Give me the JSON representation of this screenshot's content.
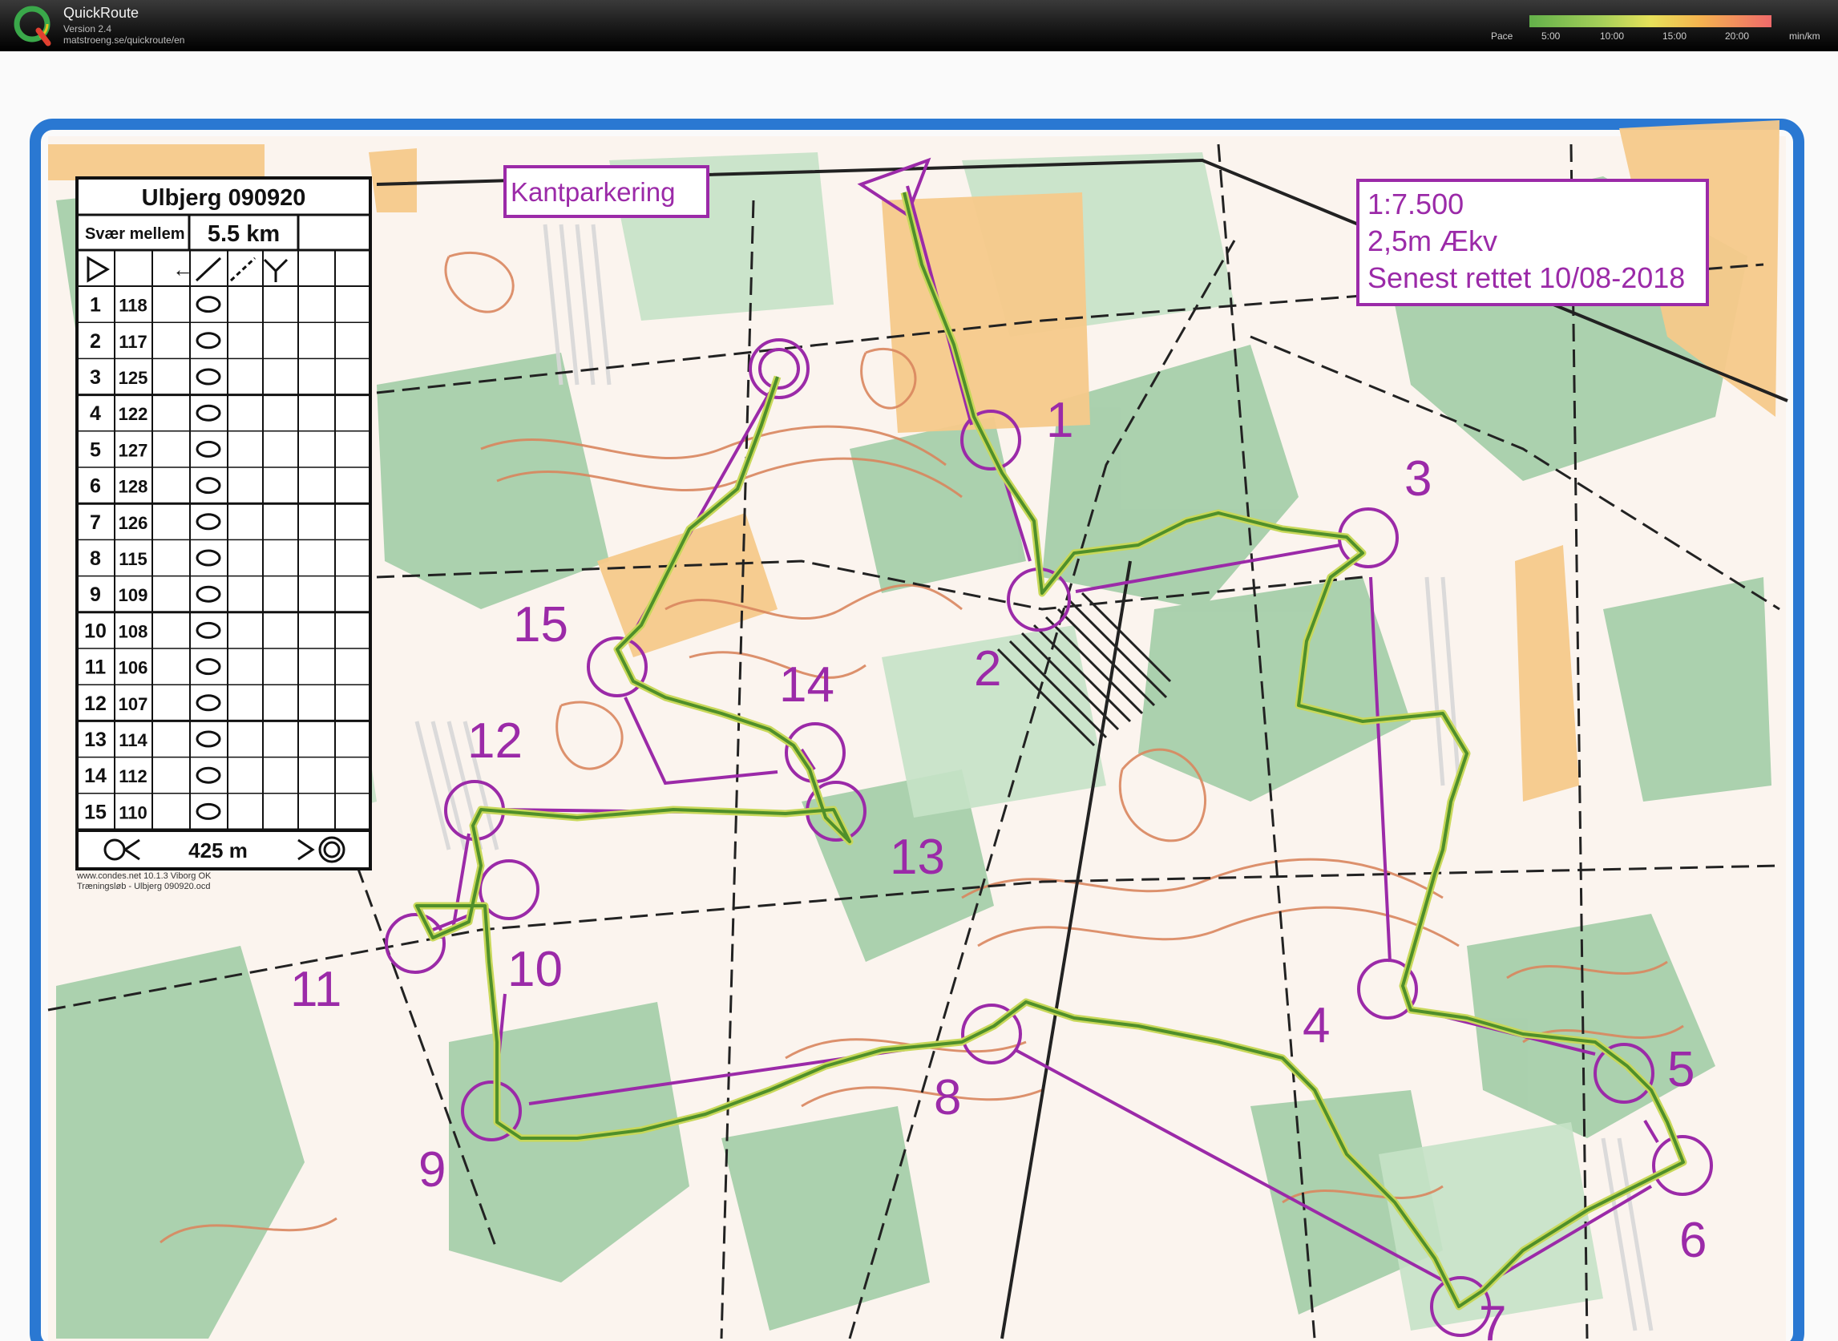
{
  "app": {
    "name": "QuickRoute",
    "version": "Version 2.4",
    "url": "matstroeng.se/quickroute/en"
  },
  "pace_legend": {
    "label": "Pace",
    "ticks": [
      "5:00",
      "10:00",
      "15:00",
      "20:00"
    ],
    "unit": "min/km"
  },
  "map": {
    "parking_label": "Kantparkering",
    "scale_box": [
      "1:7.500",
      "2,5m Ækv",
      "Senest rettet 10/08-2018"
    ],
    "footer": [
      "www.condes.net 10.1.3 Viborg OK",
      "Træningsløb - Ulbjerg 090920.ocd"
    ],
    "control_numbers": [
      "1",
      "2",
      "3",
      "4",
      "5",
      "6",
      "7",
      "8",
      "9",
      "10",
      "11",
      "12",
      "13",
      "14",
      "15"
    ]
  },
  "control_description": {
    "title": "Ulbjerg 090920",
    "category": "Svær mellem",
    "length": "5.5 km",
    "codes": [
      "118",
      "117",
      "125",
      "122",
      "127",
      "128",
      "126",
      "115",
      "109",
      "108",
      "106",
      "107",
      "114",
      "112",
      "110"
    ],
    "finish_distance": "425 m"
  },
  "colors": {
    "course": "#9b2aa8",
    "route": "#4f8f2a",
    "forest": "#8fc59a",
    "contour": "#d9865e",
    "open_land": "#f5c57a"
  }
}
